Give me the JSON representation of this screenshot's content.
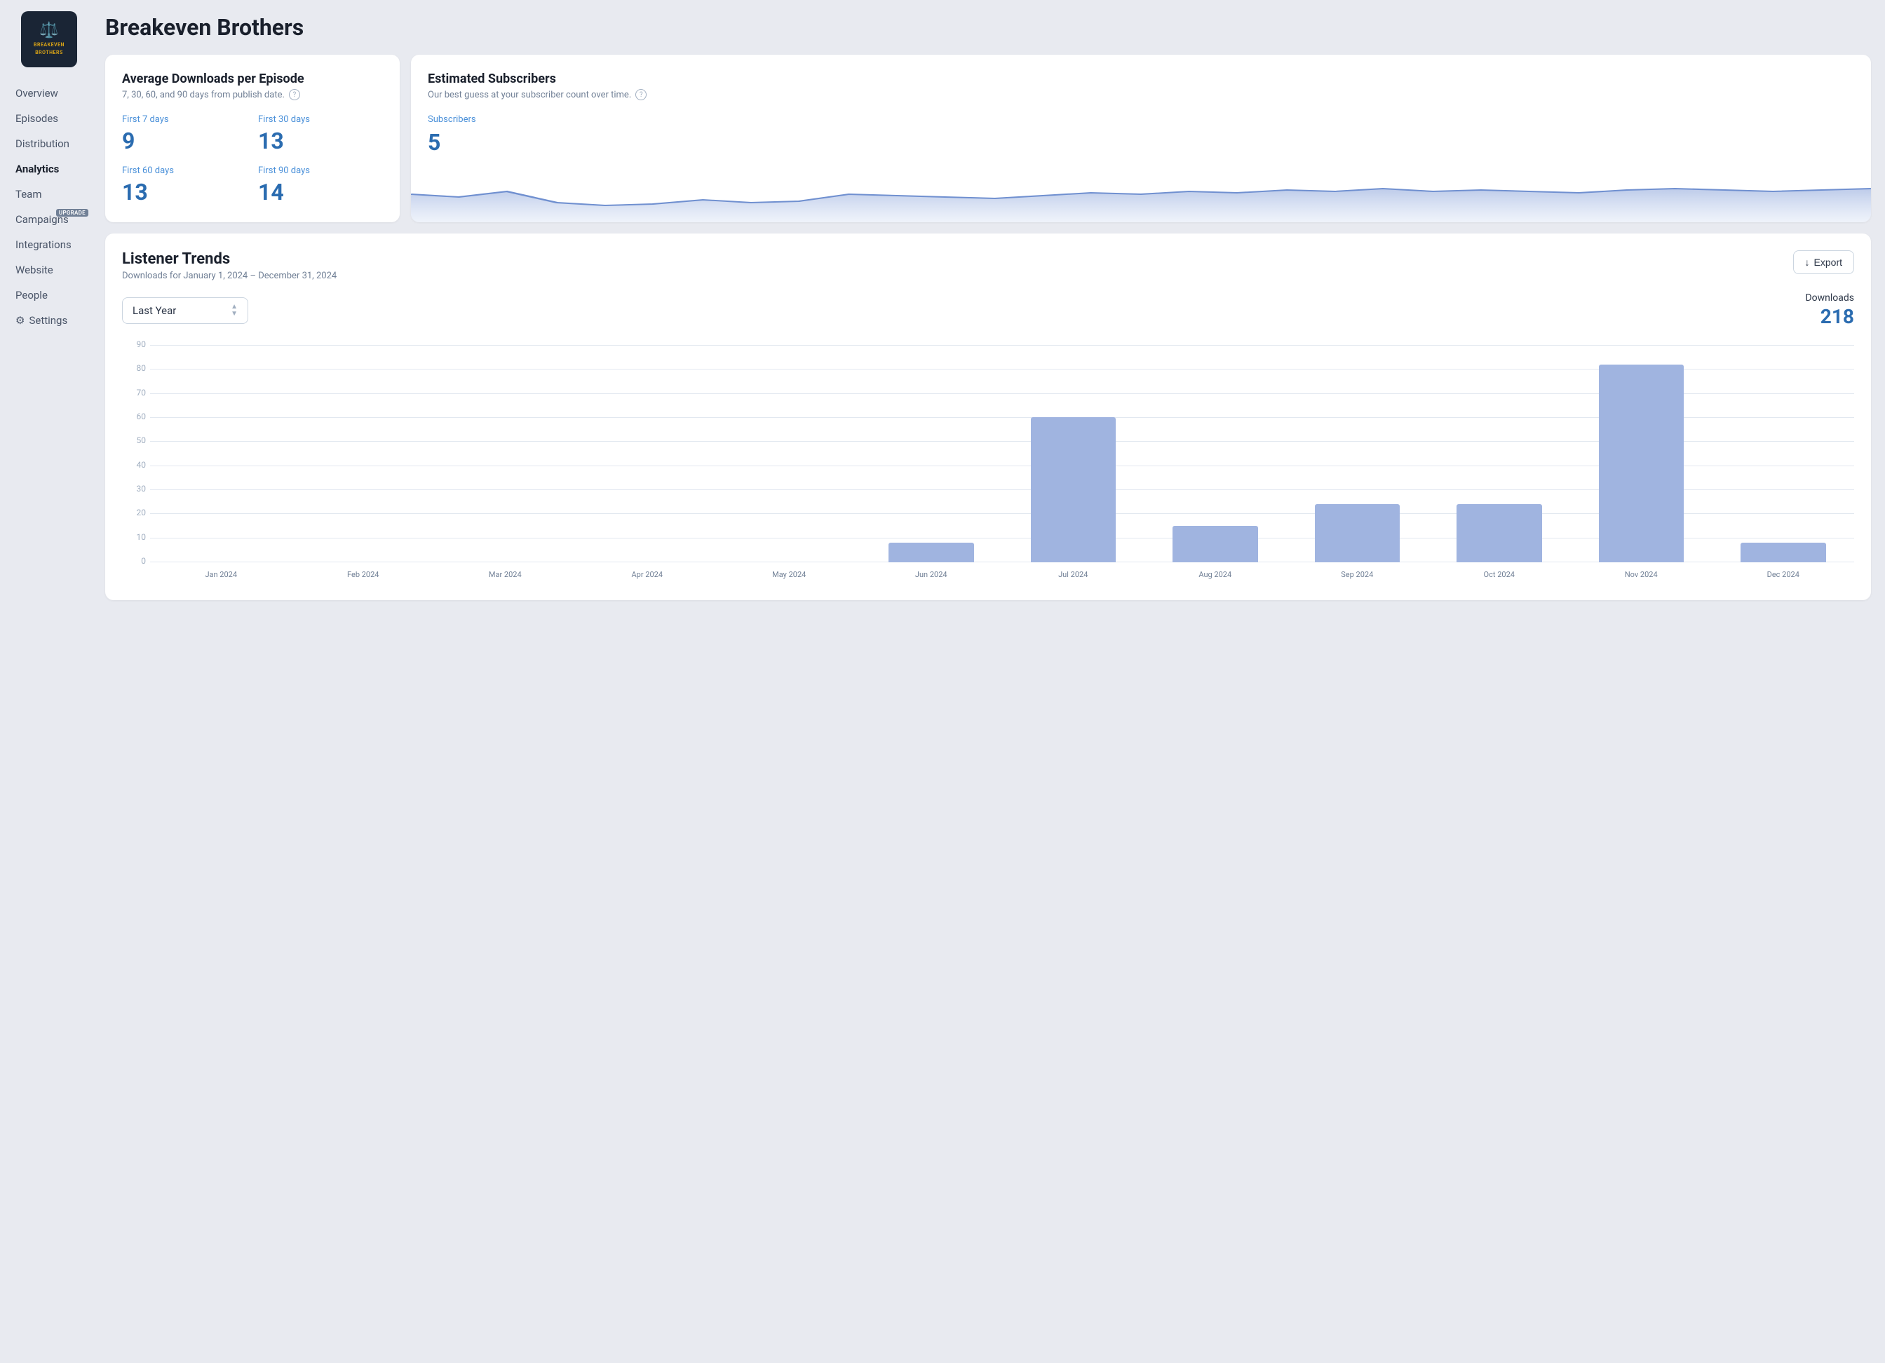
{
  "app": {
    "title": "Breakeven Brothers",
    "logo_emoji": "⚖️",
    "logo_text": "BREAKEVEN\nBROTHERS"
  },
  "sidebar": {
    "items": [
      {
        "id": "overview",
        "label": "Overview",
        "active": false
      },
      {
        "id": "episodes",
        "label": "Episodes",
        "active": false
      },
      {
        "id": "distribution",
        "label": "Distribution",
        "active": false
      },
      {
        "id": "analytics",
        "label": "Analytics",
        "active": true
      },
      {
        "id": "team",
        "label": "Team",
        "active": false,
        "badge": ""
      },
      {
        "id": "campaigns",
        "label": "Campaigns",
        "active": false,
        "badge": "UPGRADE"
      },
      {
        "id": "integrations",
        "label": "Integrations",
        "active": false
      },
      {
        "id": "website",
        "label": "Website",
        "active": false
      },
      {
        "id": "people",
        "label": "People",
        "active": false
      },
      {
        "id": "settings",
        "label": "Settings",
        "active": false,
        "icon": "gear"
      }
    ]
  },
  "downloads_card": {
    "title": "Average Downloads per Episode",
    "subtitle": "7, 30, 60, and 90 days from publish date.",
    "stats": [
      {
        "label": "First 7 days",
        "value": "9"
      },
      {
        "label": "First 30 days",
        "value": "13"
      },
      {
        "label": "First 60 days",
        "value": "13"
      },
      {
        "label": "First 90 days",
        "value": "14"
      }
    ]
  },
  "subscribers_card": {
    "title": "Estimated Subscribers",
    "subtitle": "Our best guess at your subscriber count over time.",
    "subscribers_label": "Subscribers",
    "subscribers_value": "5",
    "sparkline": [
      40,
      38,
      42,
      36,
      34,
      35,
      38,
      36,
      37,
      40,
      39,
      38,
      37,
      39,
      41,
      40,
      42,
      41,
      43,
      42,
      44,
      42,
      43,
      42,
      41,
      43,
      44,
      43,
      42,
      44
    ]
  },
  "trends_card": {
    "title": "Listener Trends",
    "subtitle": "Downloads for January 1, 2024 – December 31, 2024",
    "export_label": "Export",
    "period_label": "Last Year",
    "downloads_label": "Downloads",
    "downloads_total": "218",
    "chart": {
      "y_labels": [
        "90",
        "80",
        "70",
        "60",
        "50",
        "40",
        "30",
        "20",
        "10",
        "0"
      ],
      "y_max": 90,
      "bars": [
        {
          "month": "Jan 2024",
          "value": 0
        },
        {
          "month": "Feb 2024",
          "value": 0
        },
        {
          "month": "Mar 2024",
          "value": 0
        },
        {
          "month": "Apr 2024",
          "value": 0
        },
        {
          "month": "May 2024",
          "value": 0
        },
        {
          "month": "Jun 2024",
          "value": 8
        },
        {
          "month": "Jul 2024",
          "value": 60
        },
        {
          "month": "Aug 2024",
          "value": 15
        },
        {
          "month": "Sep 2024",
          "value": 24
        },
        {
          "month": "Oct 2024",
          "value": 24
        },
        {
          "month": "Nov 2024",
          "value": 82
        },
        {
          "month": "Dec 2024",
          "value": 8
        }
      ]
    }
  }
}
